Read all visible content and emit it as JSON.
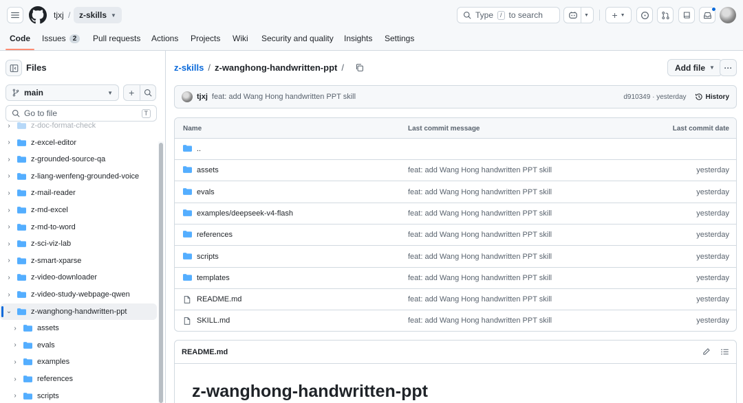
{
  "header": {
    "owner": "tjxj",
    "repo": "z-skills",
    "search_placeholder_pre": "Type",
    "search_key": "/",
    "search_placeholder_post": "to search"
  },
  "tabs": [
    {
      "label": "Code",
      "active": true
    },
    {
      "label": "Issues",
      "count": "2"
    },
    {
      "label": "Pull requests"
    },
    {
      "label": "Actions"
    },
    {
      "label": "Projects"
    },
    {
      "label": "Wiki"
    },
    {
      "label": "Security and quality"
    },
    {
      "label": "Insights"
    },
    {
      "label": "Settings"
    }
  ],
  "sidebar": {
    "title": "Files",
    "branch": "main",
    "goto_placeholder": "Go to file",
    "goto_key": "T",
    "tree": [
      {
        "label": "z-doc-format-check",
        "level": 1,
        "faded": true
      },
      {
        "label": "z-excel-editor",
        "level": 1
      },
      {
        "label": "z-grounded-source-qa",
        "level": 1
      },
      {
        "label": "z-liang-wenfeng-grounded-voice",
        "level": 1
      },
      {
        "label": "z-mail-reader",
        "level": 1
      },
      {
        "label": "z-md-excel",
        "level": 1
      },
      {
        "label": "z-md-to-word",
        "level": 1
      },
      {
        "label": "z-sci-viz-lab",
        "level": 1
      },
      {
        "label": "z-smart-xparse",
        "level": 1
      },
      {
        "label": "z-video-downloader",
        "level": 1
      },
      {
        "label": "z-video-study-webpage-qwen",
        "level": 1
      },
      {
        "label": "z-wanghong-handwritten-ppt",
        "level": 1,
        "open": true,
        "selected": true
      },
      {
        "label": "assets",
        "level": 2
      },
      {
        "label": "evals",
        "level": 2
      },
      {
        "label": "examples",
        "level": 2
      },
      {
        "label": "references",
        "level": 2
      },
      {
        "label": "scripts",
        "level": 2
      }
    ]
  },
  "main": {
    "breadcrumb_repo": "z-skills",
    "breadcrumb_folder": "z-wanghong-handwritten-ppt",
    "add_file_label": "Add file",
    "commit": {
      "author": "tjxj",
      "message": "feat: add Wang Hong handwritten PPT skill",
      "meta": "d910349 · yesterday",
      "history_label": "History"
    },
    "table": {
      "columns": [
        "Name",
        "Last commit message",
        "Last commit date"
      ],
      "rows": [
        {
          "name": "..",
          "type": "folder",
          "message": "",
          "date": ""
        },
        {
          "name": "assets",
          "type": "folder",
          "message": "feat: add Wang Hong handwritten PPT skill",
          "date": "yesterday"
        },
        {
          "name": "evals",
          "type": "folder",
          "message": "feat: add Wang Hong handwritten PPT skill",
          "date": "yesterday"
        },
        {
          "name": "examples/deepseek-v4-flash",
          "type": "folder",
          "message": "feat: add Wang Hong handwritten PPT skill",
          "date": "yesterday"
        },
        {
          "name": "references",
          "type": "folder",
          "message": "feat: add Wang Hong handwritten PPT skill",
          "date": "yesterday"
        },
        {
          "name": "scripts",
          "type": "folder",
          "message": "feat: add Wang Hong handwritten PPT skill",
          "date": "yesterday"
        },
        {
          "name": "templates",
          "type": "folder",
          "message": "feat: add Wang Hong handwritten PPT skill",
          "date": "yesterday"
        },
        {
          "name": "README.md",
          "type": "file",
          "message": "feat: add Wang Hong handwritten PPT skill",
          "date": "yesterday"
        },
        {
          "name": "SKILL.md",
          "type": "file",
          "message": "feat: add Wang Hong handwritten PPT skill",
          "date": "yesterday"
        }
      ]
    },
    "readme": {
      "title": "README.md",
      "heading": "z-wanghong-handwritten-ppt"
    }
  },
  "colors": {
    "accent": "#0969da",
    "folder": "#54aeff",
    "tab_underline": "#fd8c73"
  }
}
